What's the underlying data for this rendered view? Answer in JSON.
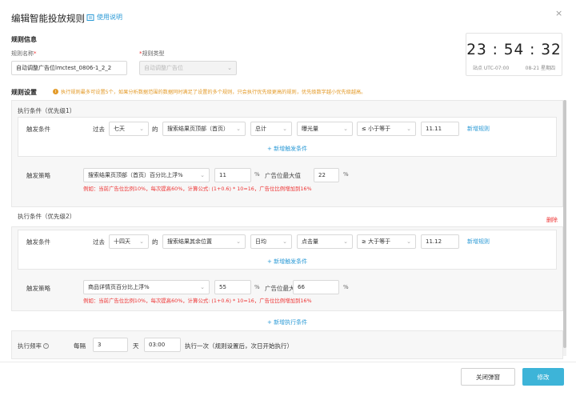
{
  "dialog": {
    "title": "编辑智能投放规则",
    "help_label": "使用说明",
    "close_glyph": "×"
  },
  "rule_info": {
    "section_title": "规则信息",
    "name_label": "规则名称",
    "name_required": "*",
    "name_value": "自动调整广告位lmctest_0806-1_2_2",
    "type_required": "*",
    "type_label": "规则类型",
    "type_value": "自动调整广告位"
  },
  "clock": {
    "time": "23 : 54 : 32",
    "zone": "站点 UTC-07:00",
    "date": "08-21 星期四"
  },
  "settings": {
    "section_title": "规则设置",
    "warning": "执行规则最多可设置5个，如果分析数据范围的数据同时满足了设置的多个规则，只会执行优先级更高的规则，优先级数字越小优先级越高。"
  },
  "condition1": {
    "title": "执行条件（优先级1）",
    "trigger_label": "触发条件",
    "past": "过去",
    "period": "七天",
    "of": "的",
    "placement": "搜索结果页顶部（首页）",
    "aggregate": "总计",
    "metric": "曝光量",
    "operator": "≤ 小于等于",
    "value": "11.11",
    "add_rule": "新增规则",
    "add_trigger": "+ 新增触发条件",
    "strategy_label": "触发策略",
    "strategy": "搜索结果页顶部（首页）百分比上浮%",
    "pct_value": "11",
    "pct_unit": "%",
    "max_label": "广告位最大值",
    "max_value": "22",
    "max_unit": "%",
    "hint": "例如：当前广告位比例10%，每次提高60%，计算公式: (1+0.6) * 10=16，广告位比例增加到16%"
  },
  "condition2": {
    "title": "执行条件（优先级2）",
    "delete": "删除",
    "trigger_label": "触发条件",
    "past": "过去",
    "period": "十四天",
    "of": "的",
    "placement": "搜索结果其余位置",
    "aggregate": "日均",
    "metric": "点击量",
    "operator": "≥ 大于等于",
    "value": "11.12",
    "add_rule": "新增规则",
    "add_trigger": "+ 新增触发条件",
    "strategy_label": "触发策略",
    "strategy": "商品详情页百分比上浮%",
    "pct_value": "55",
    "pct_unit": "%",
    "max_label": "广告位最大值",
    "max_value": "66",
    "max_unit": "%",
    "hint": "例如：当前广告位比例10%，每次提高60%，计算公式: (1+0.6) * 10=16，广告位比例增加到16%"
  },
  "add_condition": "+ 新增执行条件",
  "frequency": {
    "label": "执行频率",
    "every": "每隔",
    "days_value": "3",
    "days_unit": "天",
    "time_value": "03:00",
    "suffix": "执行一次（规则设置后，次日开始执行）"
  },
  "footer": {
    "close_label": "关闭弹窗",
    "submit_label": "修改"
  }
}
